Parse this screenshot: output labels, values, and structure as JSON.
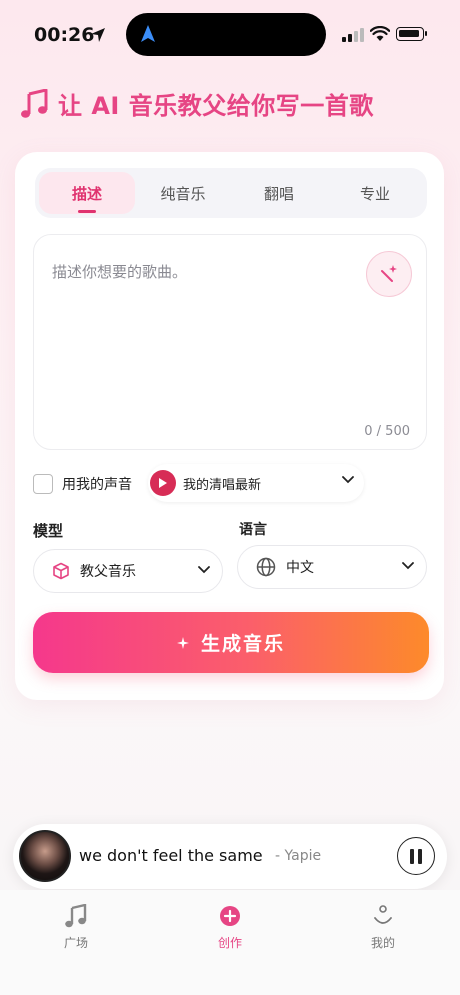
{
  "status_bar": {
    "time": "00:26"
  },
  "header": {
    "title": "让 AI 音乐教父给你写一首歌"
  },
  "tabs": [
    {
      "label": "描述",
      "active": true
    },
    {
      "label": "纯音乐",
      "active": false
    },
    {
      "label": "翻唱",
      "active": false
    },
    {
      "label": "专业",
      "active": false
    }
  ],
  "description": {
    "placeholder": "描述你想要的歌曲。",
    "counter": "0 / 500"
  },
  "voice": {
    "checkbox_label": "用我的声音",
    "selected": "我的清唱最新"
  },
  "model": {
    "label": "模型",
    "selected": "教父音乐"
  },
  "language": {
    "label": "语言",
    "selected": "中文"
  },
  "generate": {
    "label": "生成音乐"
  },
  "player": {
    "title": "we don't feel the same",
    "artist": "- Yapie"
  },
  "bottom_nav": [
    {
      "label": "广场",
      "active": false
    },
    {
      "label": "创作",
      "active": true
    },
    {
      "label": "我的",
      "active": false
    }
  ],
  "colors": {
    "accent": "#e64584",
    "gradient_start": "#f5388c",
    "gradient_end": "#fd8a2a"
  }
}
